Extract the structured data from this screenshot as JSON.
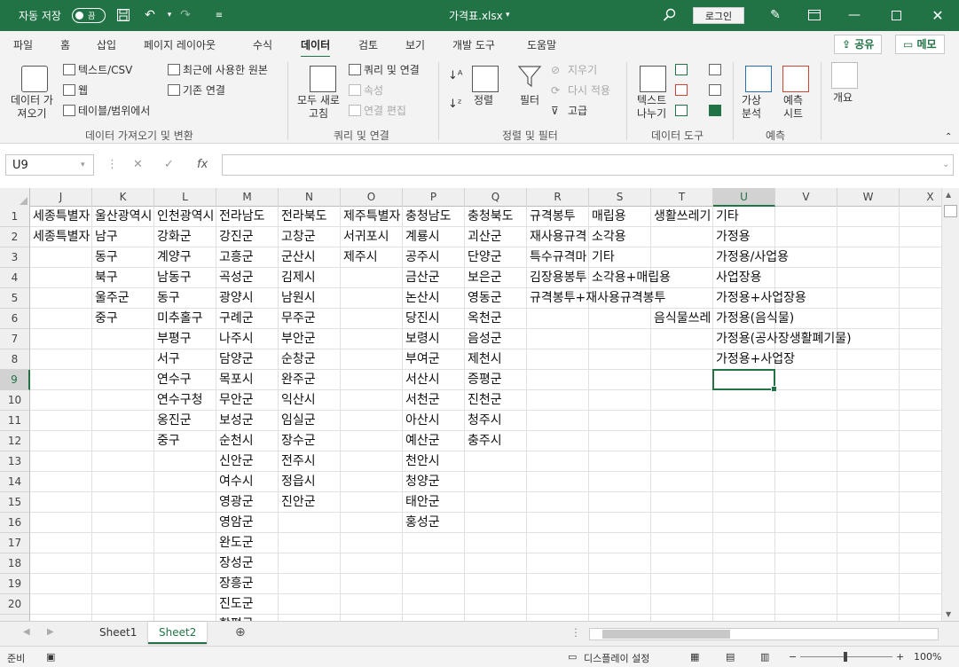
{
  "titlebar": {
    "autosave_label": "자동 저장",
    "autosave_state": "끔",
    "filename": "가격표.xlsx",
    "login": "로그인"
  },
  "menu": {
    "tabs": [
      "파일",
      "홈",
      "삽입",
      "페이지 레이아웃",
      "수식",
      "데이터",
      "검토",
      "보기",
      "개발 도구",
      "도움말"
    ],
    "active": "데이터",
    "share": "공유",
    "memo": "메모"
  },
  "ribbon": {
    "get_data": "데이터 가\n져오기",
    "text_csv": "텍스트/CSV",
    "web": "웹",
    "table_range": "테이블/범위에서",
    "recent_sources": "최근에 사용한 원본",
    "existing_conn": "기존 연결",
    "group1": "데이터 가져오기 및 변환",
    "refresh_all": "모두 새로\n고침",
    "queries_conn": "쿼리 및 연결",
    "properties": "속성",
    "edit_links": "연결 편집",
    "group2": "쿼리 및 연결",
    "sort": "정렬",
    "filter": "필터",
    "clear": "지우기",
    "reapply": "다시 적용",
    "advanced": "고급",
    "group3": "정렬 및 필터",
    "text_to_columns": "텍스트\n나누기",
    "group4": "데이터 도구",
    "what_if": "가상\n분석",
    "forecast_sheet": "예측\n시트",
    "group5": "예측",
    "outline": "개요"
  },
  "formula_bar": {
    "name_box": "U9",
    "fx": "fx",
    "content": ""
  },
  "grid": {
    "columns": [
      "J",
      "K",
      "L",
      "M",
      "N",
      "O",
      "P",
      "Q",
      "R",
      "S",
      "T",
      "U",
      "V",
      "W",
      "X"
    ],
    "selected_col": "U",
    "rows": [
      "1",
      "2",
      "3",
      "4",
      "5",
      "6",
      "7",
      "8",
      "9",
      "10",
      "11",
      "12",
      "13",
      "14",
      "15",
      "16",
      "17",
      "18",
      "19",
      "20"
    ],
    "selected_row": "9",
    "cells": {
      "J": [
        "세종특별자",
        "세종특별자"
      ],
      "K": [
        "울산광역시",
        "남구",
        "동구",
        "북구",
        "울주군",
        "중구"
      ],
      "L": [
        "인천광역시",
        "강화군",
        "계양구",
        "남동구",
        "동구",
        "미추홀구",
        "부평구",
        "서구",
        "연수구",
        "연수구청",
        "옹진군",
        "중구"
      ],
      "M": [
        "전라남도",
        "강진군",
        "고흥군",
        "곡성군",
        "광양시",
        "구례군",
        "나주시",
        "담양군",
        "목포시",
        "무안군",
        "보성군",
        "순천시",
        "신안군",
        "여수시",
        "영광군",
        "영암군",
        "완도군",
        "장성군",
        "장흥군",
        "진도군"
      ],
      "N": [
        "전라북도",
        "고창군",
        "군산시",
        "김제시",
        "남원시",
        "무주군",
        "부안군",
        "순창군",
        "완주군",
        "익산시",
        "임실군",
        "장수군",
        "전주시",
        "정읍시",
        "진안군"
      ],
      "O": [
        "제주특별자",
        "서귀포시",
        "제주시"
      ],
      "P": [
        "충청남도",
        "계룡시",
        "공주시",
        "금산군",
        "논산시",
        "당진시",
        "보령시",
        "부여군",
        "서산시",
        "서천군",
        "아산시",
        "예산군",
        "천안시",
        "청양군",
        "태안군",
        "홍성군"
      ],
      "Q": [
        "충청북도",
        "괴산군",
        "단양군",
        "보은군",
        "영동군",
        "옥천군",
        "음성군",
        "제천시",
        "증평군",
        "진천군",
        "청주시",
        "충주시"
      ],
      "R": [
        "규격봉투",
        "재사용규격",
        "특수규격마",
        "김장용봉투",
        "규격봉투+재사용규격봉투"
      ],
      "S": [
        "매립용",
        "소각용",
        "기타",
        "소각용+매립용"
      ],
      "T": [
        "생활쓰레기",
        "",
        "",
        "",
        "",
        "음식물쓰레"
      ],
      "U": [
        "기타",
        "가정용",
        "가정용/사업용",
        "사업장용",
        "가정용+사업장용",
        "가정용(음식물)",
        "가정용(공사장생활폐기물)",
        "가정용+사업장"
      ]
    },
    "hidden_row21_m": "함평군"
  },
  "sheets": {
    "tabs": [
      "Sheet1",
      "Sheet2"
    ],
    "active": "Sheet2"
  },
  "status": {
    "ready": "준비",
    "display_settings": "디스플레이 설정",
    "zoom": "100%"
  },
  "colors": {
    "accent": "#217346"
  }
}
